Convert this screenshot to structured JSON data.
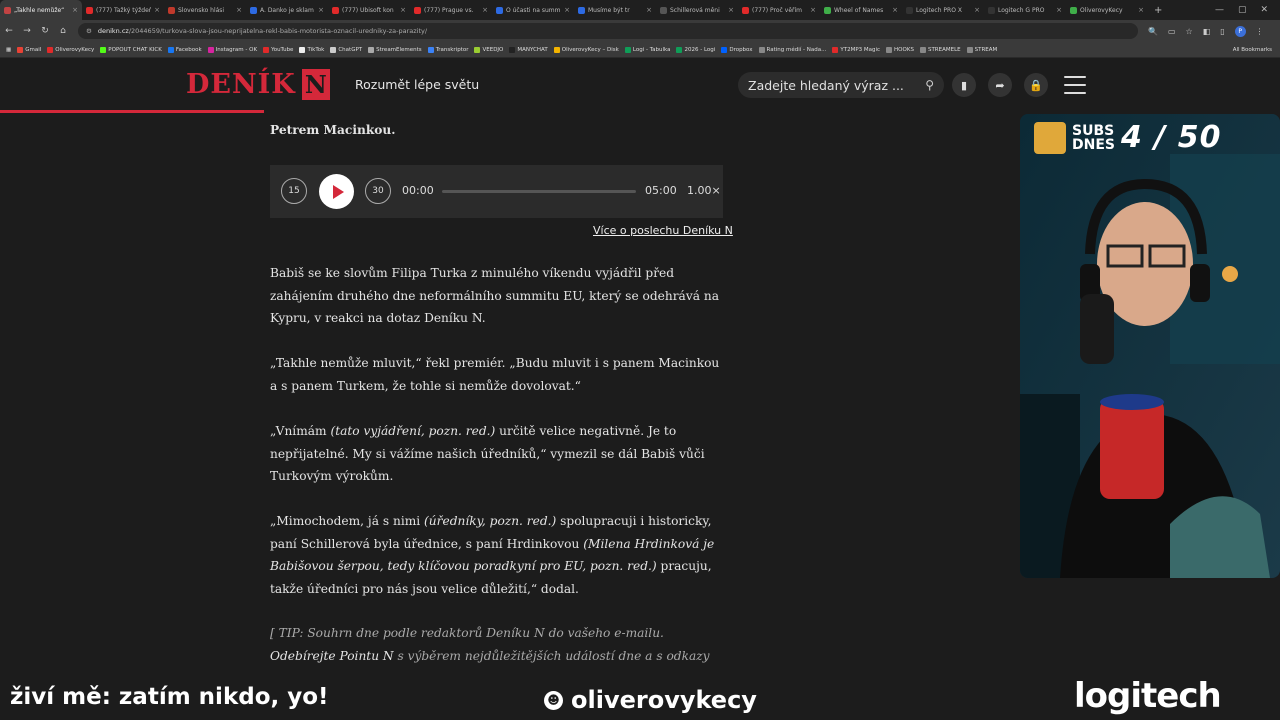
{
  "browser": {
    "tabs": [
      {
        "label": "„Takhle nemůže“",
        "color": "#c14343",
        "active": true
      },
      {
        "label": "(777) Ťažký týždeň",
        "color": "#e12a2a"
      },
      {
        "label": "Slovensko hlási",
        "color": "#c0392b"
      },
      {
        "label": "A. Danko je sklam",
        "color": "#2d6ae3"
      },
      {
        "label": "(777) Ubisoft kon",
        "color": "#e12a2a"
      },
      {
        "label": "(777) Prague vs.",
        "color": "#e12a2a"
      },
      {
        "label": "O účasti na summ",
        "color": "#2d6ae3"
      },
      {
        "label": "Musíme být tr",
        "color": "#2d6ae3"
      },
      {
        "label": "Schillerová měni",
        "color": "#555555"
      },
      {
        "label": "(777) Proč věřím",
        "color": "#e12a2a"
      },
      {
        "label": "Wheel of Names",
        "color": "#3fae49"
      },
      {
        "label": "Logitech PRO X",
        "color": "#333333"
      },
      {
        "label": "Logitech G PRO",
        "color": "#333333"
      },
      {
        "label": "OliverovyKecy",
        "color": "#3fae49"
      }
    ],
    "url_domain": "denikn.cz",
    "url_path": "/2044659/turkova-slova-jsou-neprijatelna-rekl-babis-motorista-oznacil-uredniky-za-parazity/",
    "bookmarks": [
      {
        "label": "Gmail",
        "color": "#e94235"
      },
      {
        "label": "OliverovyKecy",
        "color": "#e12a2a"
      },
      {
        "label": "POPOUT CHAT KICK",
        "color": "#53fc18"
      },
      {
        "label": "Facebook",
        "color": "#1877f2"
      },
      {
        "label": "Instagram - OK",
        "color": "#d6249f"
      },
      {
        "label": "YouTube",
        "color": "#e12a2a"
      },
      {
        "label": "TikTok",
        "color": "#eeeeee"
      },
      {
        "label": "ChatGPT",
        "color": "#cccccc"
      },
      {
        "label": "StreamElements",
        "color": "#aaaaaa"
      },
      {
        "label": "Transkriptor",
        "color": "#3b82f6"
      },
      {
        "label": "VEEDJO",
        "color": "#9acd32"
      },
      {
        "label": "MANYCHAT",
        "color": "#222222"
      },
      {
        "label": "OliverovyKecy – Disk",
        "color": "#f4b400"
      },
      {
        "label": "Logi - Tabulka",
        "color": "#0f9d58"
      },
      {
        "label": "2026 - Logi",
        "color": "#0f9d58"
      },
      {
        "label": "Dropbox",
        "color": "#0061ff"
      },
      {
        "label": "Rating médií - Nada...",
        "color": "#888888"
      },
      {
        "label": "YT2MP3 Magic",
        "color": "#e12a2a"
      },
      {
        "label": "HOOKS",
        "color": "#888888"
      },
      {
        "label": "STREAMELE",
        "color": "#888888"
      },
      {
        "label": "STREAM",
        "color": "#888888"
      }
    ],
    "all_bookmarks": "All Bookmarks",
    "profile_initial": "P"
  },
  "site": {
    "logo_text": "DENÍK",
    "logo_letter": "N",
    "tagline": "Rozumět lépe světu",
    "search_placeholder": "Zadejte hledaný výraz ...",
    "accent": "#d4283a"
  },
  "article": {
    "lead_tail": "Petrem Macinkou.",
    "player": {
      "back_label": "15",
      "fwd_label": "30",
      "current": "00:00",
      "duration": "05:00",
      "speed": "1.00×",
      "progress": 0
    },
    "more_link": "Více o poslechu Deníku N",
    "p1": "Babiš se ke slovům Filipa Turka z minulého víkendu vyjádřil před zahájením druhého dne neformálního summitu EU, který se odehrává na Kypru, v reakci na dotaz Deníku N.",
    "p2": "„Takhle nemůže mluvit,“ řekl premiér. „Budu mluvit i s panem Macinkou a s panem Turkem, že tohle si nemůže dovolovat.“",
    "p3a": "„Vnímám ",
    "p3i": "(tato vyjádření, pozn. red.)",
    "p3b": " určitě velice negativně. Je to nepřijatelné. My si vážíme našich úředníků,“ vymezil se dál Babiš vůči Turkovým výrokům.",
    "p4a": "„Mimochodem, já s nimi ",
    "p4i1": "(úředníky, pozn. red.)",
    "p4b": " spolupracuji i historicky, paní Schillerová byla úřednice, s paní Hrdinkovou ",
    "p4i2": "(Milena Hrdinková je Babišovou šerpou, tedy klíčovou poradkyní pro EU, pozn. red.)",
    "p4c": " pracuju, takže úředníci pro nás jsou velice důležití,“ dodal.",
    "tip_a": "[ TIP: Souhrn dne podle redaktorů Deníku N do vašeho e-mailu. ",
    "tip_b": "Odebírejte Pointu N",
    "tip_c": " s výběrem nejdůležitějších událostí dne a s odkazy na zajímavé texty. ]"
  },
  "stream": {
    "subs_label_1": "SUBS",
    "subs_label_2": "DNES",
    "subs_count": "4 / 50",
    "live_text": "živí mě: zatím nikdo, yo!",
    "channel_name": "oliverovykecy",
    "sponsor": "logitech"
  }
}
